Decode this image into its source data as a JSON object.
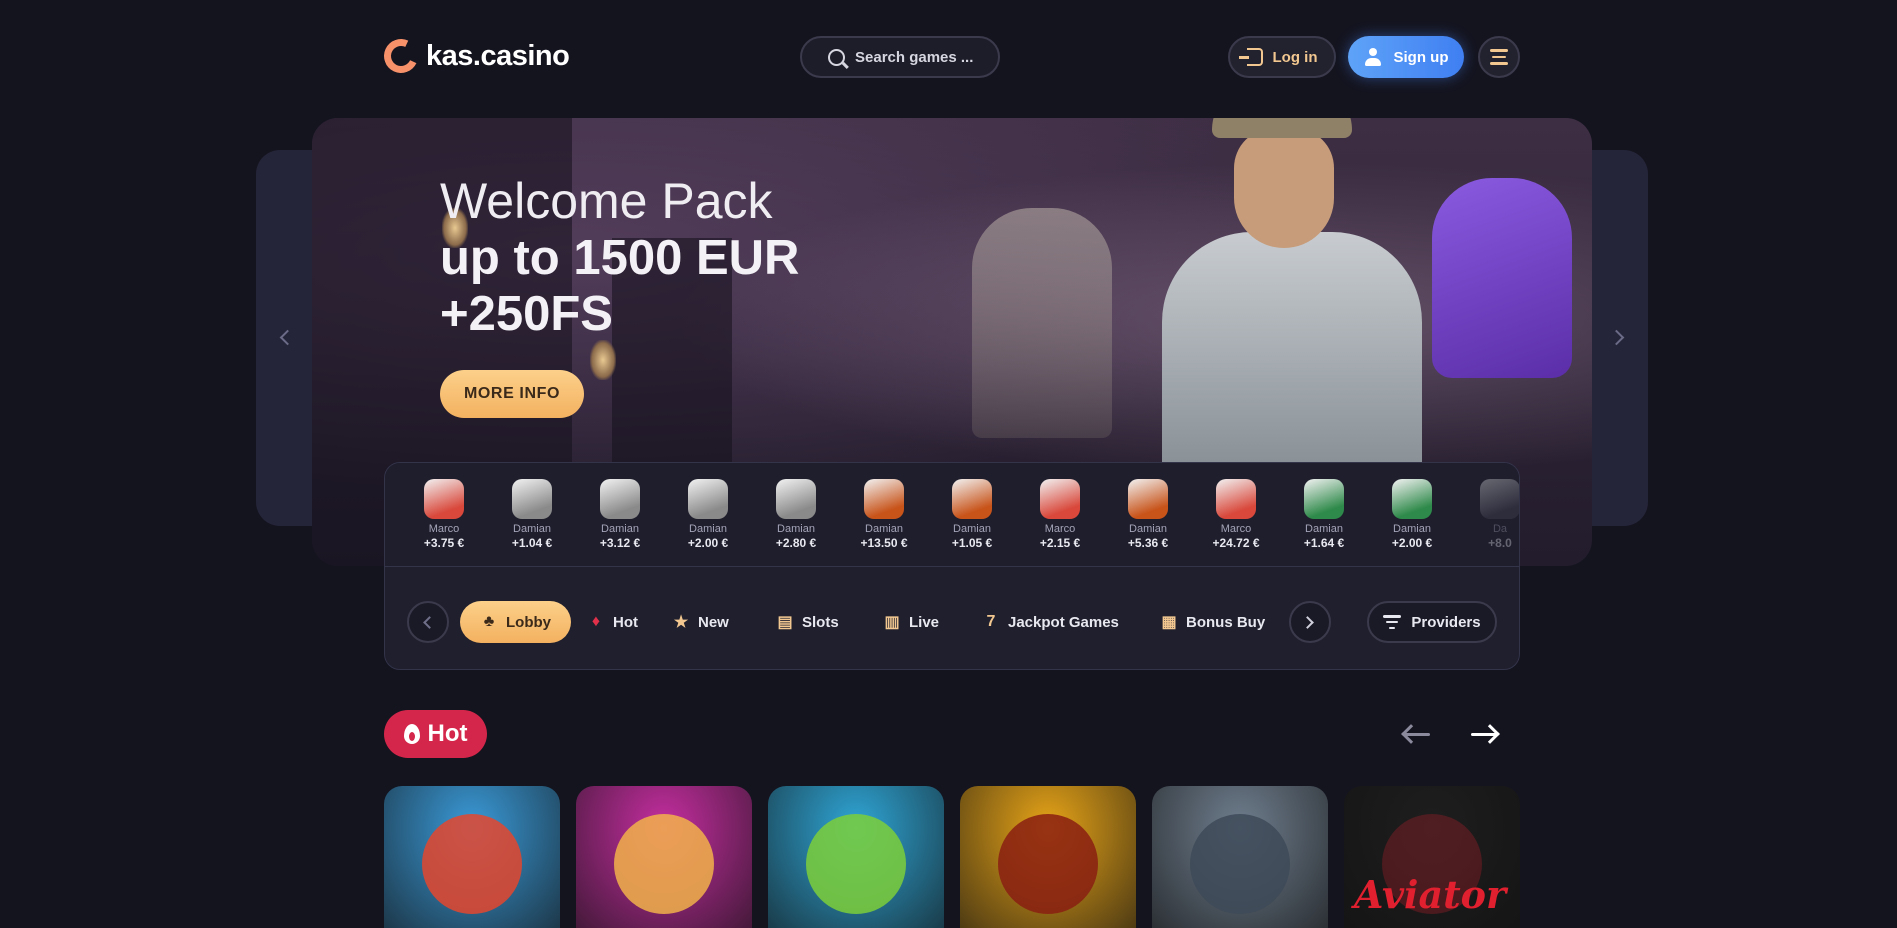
{
  "header": {
    "logo_text": "kas.casino",
    "search_placeholder": "Search games ...",
    "login_label": "Log in",
    "signup_label": "Sign up"
  },
  "banner": {
    "line1": "Welcome Pack",
    "line2": "up to 1500 EUR",
    "line3": "+250FS",
    "button_label": "MORE INFO"
  },
  "wins": [
    {
      "name": "Marco",
      "amount": "+3.75 €",
      "game_color": "#d9483b"
    },
    {
      "name": "Damian",
      "amount": "+1.04 €",
      "game_color": "#8a8a8a"
    },
    {
      "name": "Damian",
      "amount": "+3.12 €",
      "game_color": "#8a8a8a"
    },
    {
      "name": "Damian",
      "amount": "+2.00 €",
      "game_color": "#8a8a8a"
    },
    {
      "name": "Damian",
      "amount": "+2.80 €",
      "game_color": "#8a8a8a"
    },
    {
      "name": "Damian",
      "amount": "+13.50 €",
      "game_color": "#c8541a"
    },
    {
      "name": "Damian",
      "amount": "+1.05 €",
      "game_color": "#c8541a"
    },
    {
      "name": "Marco",
      "amount": "+2.15 €",
      "game_color": "#d9483b"
    },
    {
      "name": "Damian",
      "amount": "+5.36 €",
      "game_color": "#c8541a"
    },
    {
      "name": "Marco",
      "amount": "+24.72 €",
      "game_color": "#d9483b"
    },
    {
      "name": "Damian",
      "amount": "+1.64 €",
      "game_color": "#2e8a4a"
    },
    {
      "name": "Damian",
      "amount": "+2.00 €",
      "game_color": "#2e8a4a"
    },
    {
      "name": "Da",
      "amount": "+8.0",
      "game_color": "#4a4a5a"
    }
  ],
  "categories": [
    {
      "label": "Lobby",
      "icon": "cherries-icon",
      "glyph": "♣",
      "active": true
    },
    {
      "label": "Hot",
      "icon": "flame-icon",
      "glyph": "♦",
      "active": false
    },
    {
      "label": "New",
      "icon": "star-icon",
      "glyph": "★",
      "active": false
    },
    {
      "label": "Slots",
      "icon": "slot-machine-icon",
      "glyph": "▤",
      "active": false
    },
    {
      "label": "Live",
      "icon": "cards-icon",
      "glyph": "▥",
      "active": false
    },
    {
      "label": "Jackpot Games",
      "icon": "seven-icon",
      "glyph": "7",
      "active": false
    },
    {
      "label": "Bonus Buy",
      "icon": "gift-icon",
      "glyph": "▦",
      "active": false
    }
  ],
  "providers_label": "Providers",
  "hot_section": {
    "title": "Hot",
    "games": [
      {
        "name": "octopus-game",
        "bg": "#3a9ad8",
        "accent": "#e4472e"
      },
      {
        "name": "day-of-dead-game",
        "bg": "#c52ea0",
        "accent": "#f2b24a"
      },
      {
        "name": "frog-elvis-game",
        "bg": "#2fa6d6",
        "accent": "#7ccf3a"
      },
      {
        "name": "gold-pot-game",
        "bg": "#e7a418",
        "accent": "#8a1f12"
      },
      {
        "name": "viking-game",
        "bg": "#6f7e8e",
        "accent": "#3e4a58"
      },
      {
        "name": "aviator-game",
        "bg": "#1e1e1e",
        "accent": "#e0202e",
        "label": "Aviator"
      }
    ]
  },
  "colors": {
    "background": "#14141f",
    "accent_gold": "#f3b160",
    "signup_blue": "#3f7ff2",
    "hot_red": "#d4264a"
  }
}
